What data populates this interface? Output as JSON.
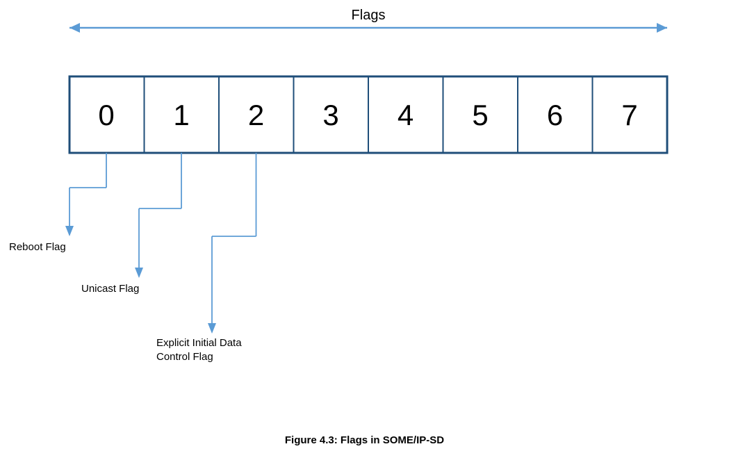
{
  "diagram": {
    "title": "Flags",
    "bits": [
      "0",
      "1",
      "2",
      "3",
      "4",
      "5",
      "6",
      "7"
    ],
    "labels": [
      {
        "id": "reboot",
        "text": "Reboot Flag",
        "bit": 0
      },
      {
        "id": "unicast",
        "text": "Unicast Flag",
        "bit": 1
      },
      {
        "id": "explicit",
        "text1": "Explicit Initial Data",
        "text2": "Control Flag",
        "bit": 2
      }
    ],
    "caption": "Figure 4.3: Flags in SOME/IP-SD",
    "arrowColor": "#5b9bd5",
    "boxBorderColor": "#1f4e79",
    "boxFill": "#ffffff"
  }
}
